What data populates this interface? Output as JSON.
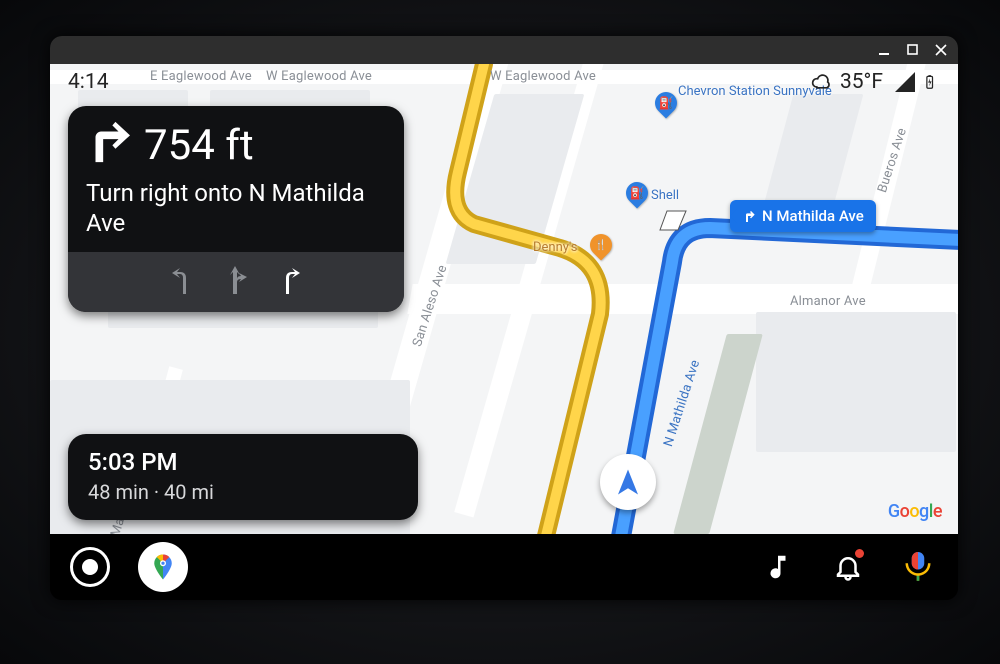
{
  "window": {
    "minimize_icon": "minimize",
    "maximize_icon": "maximize",
    "close_icon": "close"
  },
  "status": {
    "time": "4:14",
    "temp": "35°F",
    "weather_icon": "cloud",
    "signal_icon": "cell-signal",
    "battery_icon": "battery-charging"
  },
  "nav": {
    "maneuver_icon": "turn-right",
    "distance": "754 ft",
    "instruction": "Turn right onto N Mathilda Ave",
    "lanes": [
      {
        "type": "left",
        "active": false
      },
      {
        "type": "straight-right",
        "active": false
      },
      {
        "type": "right",
        "active": true
      }
    ]
  },
  "eta": {
    "arrival_time": "5:03 PM",
    "duration": "48 min",
    "distance": "40 mi"
  },
  "map": {
    "current_street_chip": "N Mathilda Ave",
    "streets": {
      "eaglewood_w": "W Eaglewood Ave",
      "eaglewood_e": "E Eaglewood Ave",
      "almanor": "Almanor Ave",
      "san_aleso": "San Aleso Ave",
      "madrone": "Madrone Ave",
      "n_mathilda": "N Mathilda Ave",
      "bueros": "Bueros Ave"
    },
    "pois": {
      "chevron": "Chevron Station Sunnyvale",
      "shell": "Shell",
      "dennys": "Denny's"
    },
    "watermark": "Google"
  },
  "rail": {
    "launcher_icon": "launcher",
    "maps_icon": "google-maps",
    "media_icon": "music-note",
    "notifications_icon": "bell",
    "assistant_icon": "google-assistant",
    "has_notification": true
  }
}
